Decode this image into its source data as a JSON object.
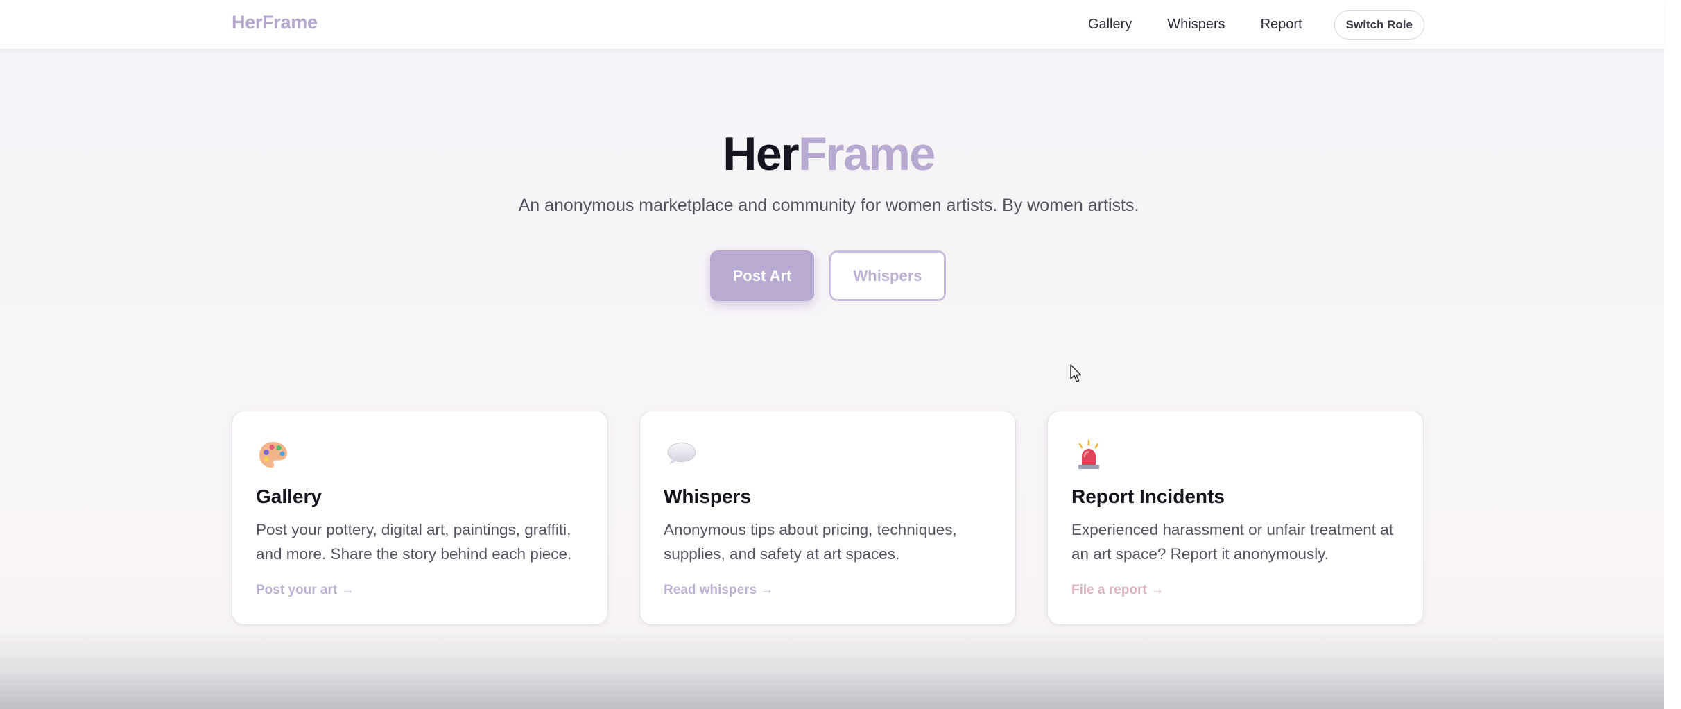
{
  "nav": {
    "brand": "HerFrame",
    "links": [
      "Gallery",
      "Whispers",
      "Report"
    ],
    "switch_role": "Switch Role"
  },
  "hero": {
    "title_part1": "Her",
    "title_part2": "Frame",
    "subtitle": "An anonymous marketplace and community for women artists. By women artists.",
    "primary_button": "Post Art",
    "secondary_button": "Whispers"
  },
  "cards": [
    {
      "icon": "palette-icon",
      "title": "Gallery",
      "description": "Post your pottery, digital art, paintings, graffiti, and more. Share the story behind each piece.",
      "link": "Post your art →"
    },
    {
      "icon": "speech-bubble-icon",
      "title": "Whispers",
      "description": "Anonymous tips about pricing, techniques, supplies, and safety at art spaces.",
      "link": "Read whispers →"
    },
    {
      "icon": "siren-icon",
      "title": "Report Incidents",
      "description": "Experienced harassment or unfair treatment at an art space? Report it anonymously.",
      "link": "File a report →"
    }
  ],
  "colors": {
    "brand": "#b7a9cf",
    "primary_button": "#b9aad1",
    "report_link": "#d9b1bf"
  }
}
